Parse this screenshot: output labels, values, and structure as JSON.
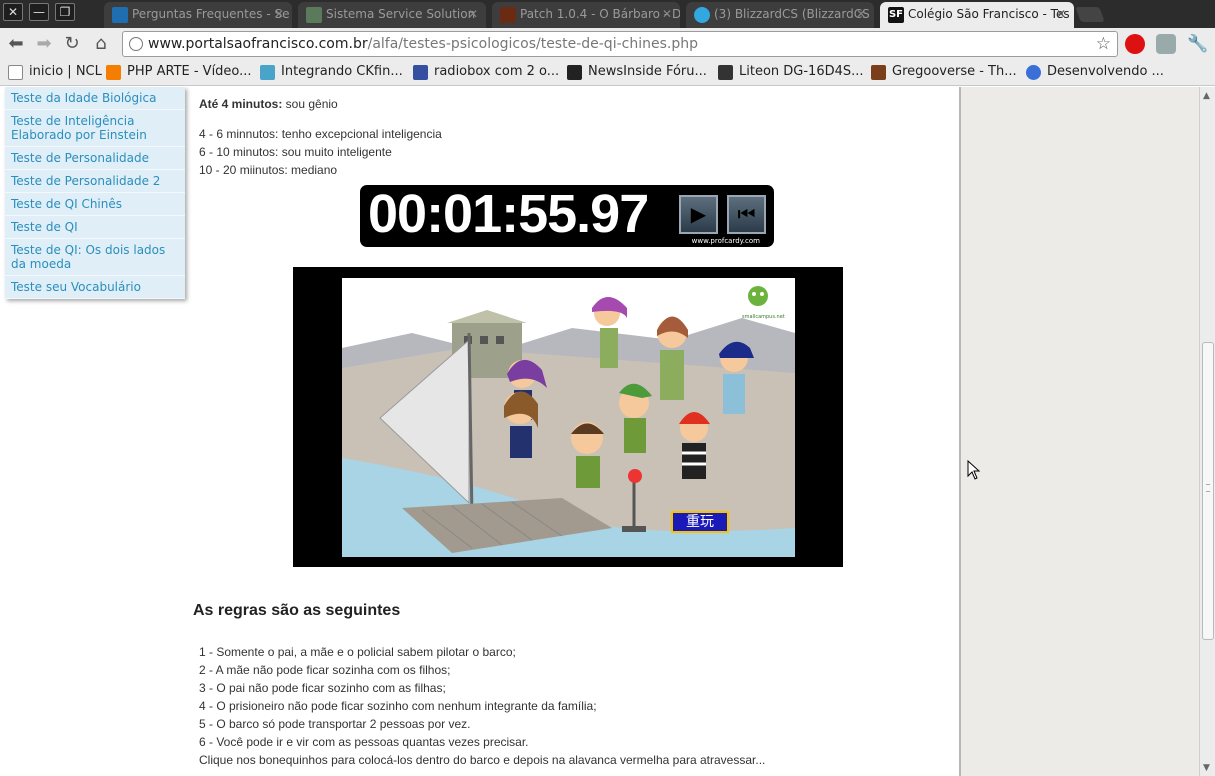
{
  "tabs": [
    {
      "title": "Perguntas Frequentes - Se",
      "icon": "diablo-icon",
      "active": false
    },
    {
      "title": "Sistema Service Solution",
      "icon": "service-icon",
      "active": false
    },
    {
      "title": "Patch 1.0.4 - O Bárbaro - D",
      "icon": "diablo-d-icon",
      "active": false
    },
    {
      "title": "(3) BlizzardCS (BlizzardCS",
      "icon": "twitter-bird-icon",
      "active": false
    },
    {
      "title": "Colégio São Francisco - Tes",
      "icon": "sf-icon",
      "active": true
    }
  ],
  "window_controls": {
    "close": "✕",
    "minimize": "—",
    "restore": "❐"
  },
  "address": {
    "domain": "www.portalsaofrancisco.com.br",
    "path": "/alfa/testes-psicologicos/teste-de-qi-chines.php"
  },
  "bookmarks": [
    {
      "label": "inicio | NCL",
      "icon": "page-icon"
    },
    {
      "label": "PHP ARTE - Vídeo...",
      "icon": "blogger-icon"
    },
    {
      "label": "Integrando CKfin...",
      "icon": "cube-icon"
    },
    {
      "label": "radiobox com 2 o...",
      "icon": "slash-icon"
    },
    {
      "label": "NewsInside Fóru...",
      "icon": "nf-icon"
    },
    {
      "label": "Liteon DG-16D4S...",
      "icon": "dx-icon"
    },
    {
      "label": "Gregooverse - Th...",
      "icon": "film-icon"
    },
    {
      "label": "Desenvolvendo ...",
      "icon": "swirl-icon"
    }
  ],
  "side_menu": [
    "Teste da Idade Biológica",
    "Teste de Inteligência Elaborado por Einstein",
    "Teste de Personalidade",
    "Teste de Personalidade 2",
    "Teste de QI Chinês",
    "Teste de QI",
    "Teste de QI: Os dois lados da moeda",
    "Teste seu Vocabulário"
  ],
  "scores": {
    "first_bold": "Até 4 minutos:",
    "first_rest": " sou gênio",
    "lines": [
      "4 - 6 minnutos: tenho excepcional inteligencia",
      "6 - 10 minutos: sou muito inteligente",
      "10 - 20 miinutos: mediano"
    ]
  },
  "stopwatch": {
    "time": "00:01:55.97",
    "play": "▶",
    "reset": "⏮",
    "credit": "www.profcardy.com"
  },
  "game": {
    "replay_label": "重玩",
    "logo_text": "smallcampus.net"
  },
  "rules": {
    "heading": "As regras são as seguintes",
    "items": [
      "1 - Somente o pai, a mãe e o policial sabem pilotar o barco;",
      "2 - A mãe não pode ficar sozinha com os filhos;",
      "3 - O pai não pode ficar sozinho com as filhas;",
      "4 - O prisioneiro não pode ficar sozinho com nenhum integrante da família;",
      "5 - O barco só pode transportar 2 pessoas por vez.",
      "6 - Você pode ir e vir com as pessoas quantas vezes precisar.",
      "Clique nos bonequinhos para colocá-los dentro do barco e depois na alavanca vermelha para atravessar..."
    ]
  }
}
